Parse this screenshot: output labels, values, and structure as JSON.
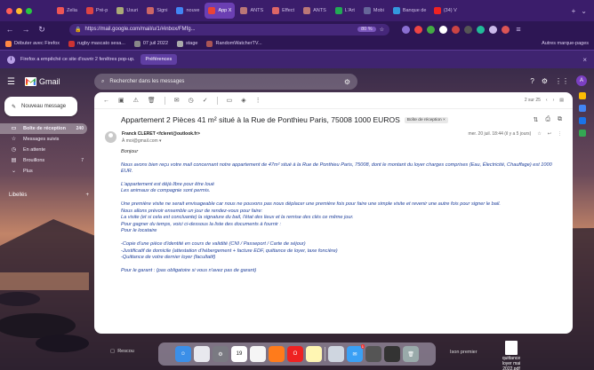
{
  "colors": {
    "browser": "#3b1d6b",
    "accent": "#6b3fb3",
    "gmail_red": "#ea4335"
  },
  "tabs": [
    {
      "label": "Zelia",
      "icon": "page-icon",
      "color": "#e55"
    },
    {
      "label": "Pré-p",
      "icon": "page-icon",
      "color": "#d44"
    },
    {
      "label": "Usuri",
      "icon": "page-icon",
      "color": "#aa7"
    },
    {
      "label": "Signi",
      "icon": "page-icon",
      "color": "#c66"
    },
    {
      "label": "nouve",
      "icon": "google-icon",
      "color": "#4285f4"
    },
    {
      "label": "App X",
      "icon": "gmail-icon",
      "color": "#ea4335",
      "active": true
    },
    {
      "label": "ANTS",
      "icon": "page-icon",
      "color": "#b77"
    },
    {
      "label": "Effect",
      "icon": "page-icon",
      "color": "#d66"
    },
    {
      "label": "ANTS",
      "icon": "page-icon",
      "color": "#b77"
    },
    {
      "label": "L'Art",
      "icon": "flag-icon",
      "color": "#2a5"
    },
    {
      "label": "Mobi",
      "icon": "page-icon",
      "color": "#669"
    },
    {
      "label": "Banque de",
      "icon": "page-icon",
      "color": "#39d"
    },
    {
      "label": "(34) V",
      "icon": "youtube-icon",
      "color": "#e22"
    }
  ],
  "nav": {
    "url": "https://mail.google.com/mail/u/1/#inbox/FMfg...",
    "zoom": "80 %"
  },
  "bookmarks": {
    "items": [
      {
        "label": "Débuter avec Firefox",
        "color": "#f84"
      },
      {
        "label": "rugby mascato sesa...",
        "color": "#c33"
      },
      {
        "label": "07 juil 2022",
        "color": "#888"
      },
      {
        "label": "stage",
        "color": "#aaa"
      },
      {
        "label": "RandomWatcherTV...",
        "color": "#a55"
      }
    ],
    "other": "Autres marque-pages"
  },
  "notification": {
    "text": "Firefox a empêché ce site d'ouvrir 2 fenêtres pop-up.",
    "button": "Préférences"
  },
  "gmail": {
    "logo": "Gmail",
    "search_placeholder": "Rechercher dans les messages",
    "avatar": "A",
    "compose": "Nouveau message",
    "sidebar": [
      {
        "label": "Boîte de réception",
        "count": "240",
        "icon": "inbox-icon",
        "active": true
      },
      {
        "label": "Messages suivis",
        "count": "",
        "icon": "star-icon"
      },
      {
        "label": "En attente",
        "count": "",
        "icon": "clock-icon"
      },
      {
        "label": "Brouillons",
        "count": "7",
        "icon": "file-icon"
      },
      {
        "label": "Plus",
        "count": "",
        "icon": "chevron-down-icon"
      }
    ],
    "labels_header": "Libellés",
    "pager": "2 sur 25"
  },
  "email": {
    "subject": "Appartement 2 Pièces 41 m² situé à la Rue de Ponthieu Paris, 75008 1000 EUROS",
    "label": "Boîte de réception ×",
    "sender_name": "Franck CLERET <fcleret@outlook.fr>",
    "to": "À moi@gmail.com ▾",
    "date": "mer. 20 juil. 18:44 (il y a 5 jours)",
    "greeting": "Bonjour",
    "paragraphs": [
      "Nous avons bien reçu votre mail concernant notre appartement de 47m² situé à la Rue de Ponthieu Paris, 75008, dont le montant du loyer charges comprises (Eau, Électricité, Chauffage) est 1000 EUR.",
      "L'appartement est déjà libre pour être loué\nLes animaux de compagnie sont permis.",
      "Une première visite ne serait envisageable car nous ne pouvons pas nous déplacer une première fois pour faire une simple visite et revenir une autre fois pour signer le bail.\nNous allons prévoir ensemble un jour de rendez-vous pour faire:\nLa visite (et si cela est concluante) la signature du bail, l'état des lieux et la remise des clés ce même jour.\nPour gagner du temps, voici ci-dessous la liste des documents à fournir :\nPour le locataire",
      "-Copie d'une pièce d'identité en cours de validité (CNI / Passeport / Carte de séjour)\n-Justificatif de domicile (attestation d'hébergement + facture EDF, quittance de loyer, taxe foncière)\n-Quittance de votre dernier loyer (facultatif)",
      "Pour le garant : (pas obligatoire si vous n'avez pas de garant)"
    ]
  },
  "desktop": {
    "left_label": "Rescou",
    "right_label": "Ison premier",
    "calendar_day": "19",
    "mail_badge": "1",
    "file_label": "quittance loyer mai 2022.pdf"
  }
}
